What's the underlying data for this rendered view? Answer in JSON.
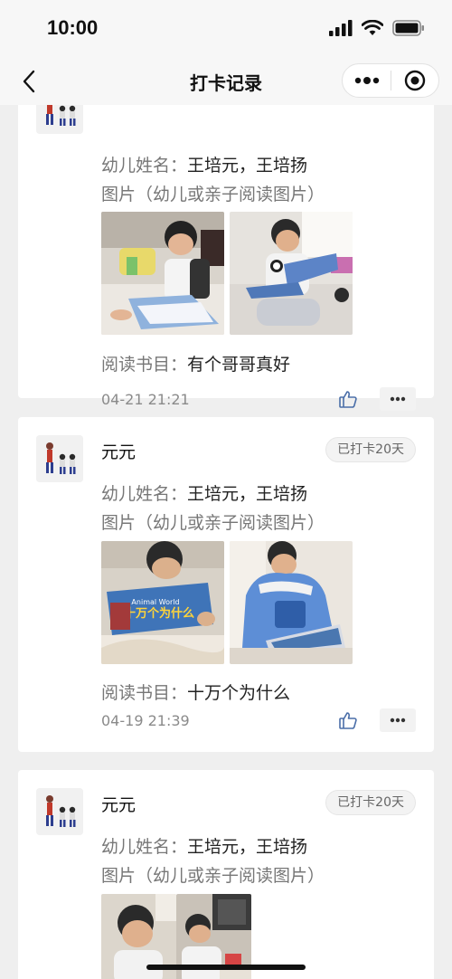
{
  "status_bar": {
    "time": "10:00"
  },
  "nav": {
    "title": "打卡记录"
  },
  "labels": {
    "name_prefix": "幼儿姓名：",
    "photo_caption": "图片（幼儿或亲子阅读图片）",
    "book_prefix": "阅读书目："
  },
  "posts": [
    {
      "child_names": "王培元，王培扬",
      "book": "有个哥哥真好",
      "time": "04-21 21:21"
    },
    {
      "user": "元元",
      "badge": "已打卡20天",
      "child_names": "王培元，王培扬",
      "book": "十万个为什么",
      "time": "04-19 21:39"
    },
    {
      "user": "元元",
      "badge": "已打卡20天",
      "child_names": "王培元，王培扬"
    }
  ],
  "photo_texts": {
    "book_cover_title": "十万个为什么",
    "book_cover_sub": "Animal World"
  },
  "colors": {
    "accent_like": "#4a6ea8",
    "background": "#efefef"
  }
}
